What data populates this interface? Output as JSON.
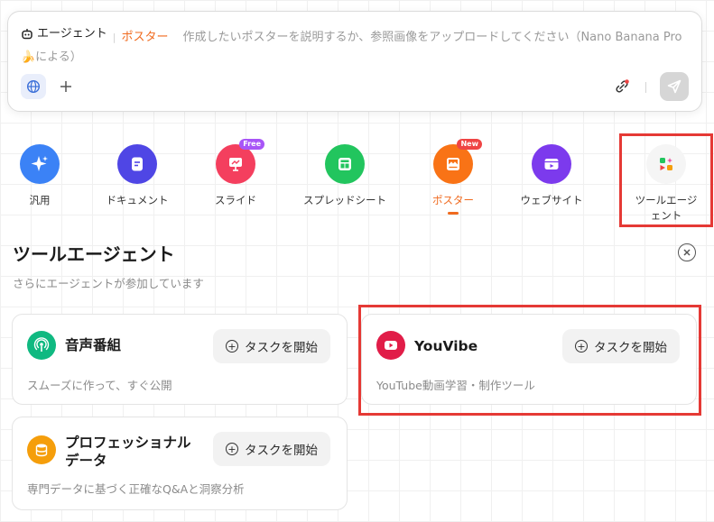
{
  "prompt": {
    "agent_label": "エージェント",
    "mode_label": "ポスター",
    "placeholder": "作成したいポスターを説明するか、参照画像をアップロードしてください（Nano Banana Pro🍌による）"
  },
  "categories": [
    {
      "label": "汎用",
      "color": "#3b82f6",
      "icon": "sparkle-icon"
    },
    {
      "label": "ドキュメント",
      "color": "#4f46e5",
      "icon": "document-icon"
    },
    {
      "label": "スライド",
      "color": "#f43f5e",
      "icon": "presentation-icon",
      "badge": "Free"
    },
    {
      "label": "スプレッドシート",
      "color": "#22c55e",
      "icon": "spreadsheet-icon"
    },
    {
      "label": "ポスター",
      "color": "#f97316",
      "icon": "poster-icon",
      "badge": "New",
      "active": true
    },
    {
      "label": "ウェブサイト",
      "color": "#7c3aed",
      "icon": "website-icon"
    },
    {
      "label": "ツールエージェント",
      "color": "#f5f5f5",
      "icon": "tool-agent-icon"
    }
  ],
  "section": {
    "title": "ツールエージェント",
    "subtitle": "さらにエージェントが参加しています"
  },
  "cards": [
    {
      "name": "音声番組",
      "desc": "スムーズに作って、すぐ公開",
      "button": "タスクを開始",
      "icon": "podcast-icon",
      "color": "#10b981"
    },
    {
      "name": "YouVibe",
      "desc": "YouTube動画学習・制作ツール",
      "button": "タスクを開始",
      "icon": "youtube-icon",
      "color": "#e11d48"
    },
    {
      "name": "プロフェッショナル\nデータ",
      "desc": "専門データに基づく正確なQ&Aと洞察分析",
      "button": "タスクを開始",
      "icon": "database-icon",
      "color": "#f59e0b"
    }
  ]
}
